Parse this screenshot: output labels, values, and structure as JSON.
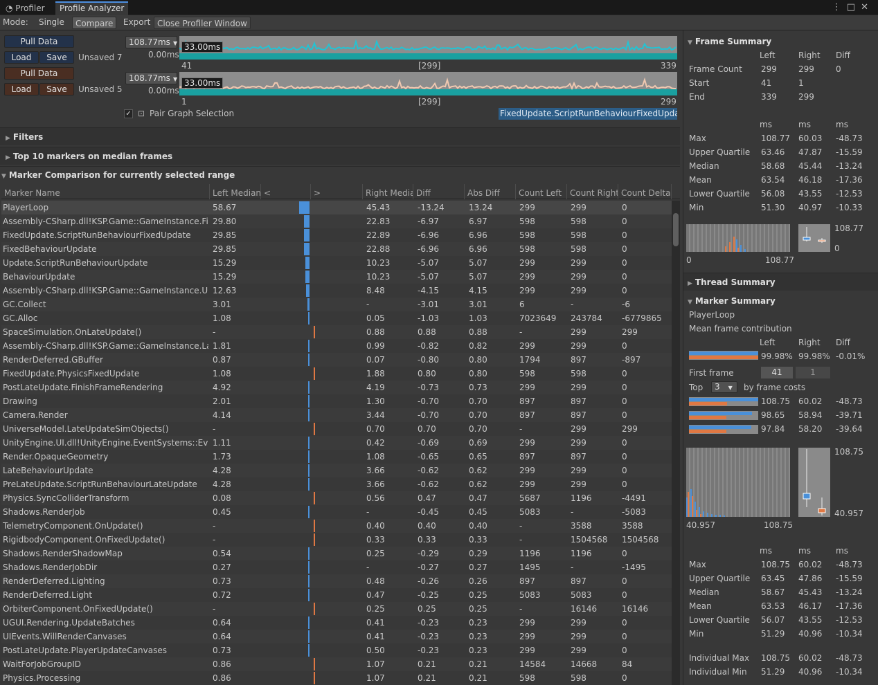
{
  "tabs": {
    "profiler": "Profiler",
    "analyzer": "Profile Analyzer"
  },
  "toolbar": {
    "mode": "Mode:",
    "single": "Single",
    "compare": "Compare",
    "export": "Export",
    "close": "Close Profiler Window"
  },
  "left_set": {
    "pull": "Pull Data",
    "load": "Load",
    "save": "Save",
    "status": "Unsaved 7",
    "max": "108.77ms",
    "min": "0.00ms",
    "target": "33.00ms",
    "axis_start": "41",
    "axis_mid": "[299]",
    "axis_end": "339"
  },
  "right_set": {
    "pull": "Pull Data",
    "load": "Load",
    "save": "Save",
    "status": "Unsaved 5",
    "max": "108.77ms",
    "min": "0.00ms",
    "target": "33.00ms",
    "axis_start": "1",
    "axis_mid": "[299]",
    "axis_end": "299"
  },
  "pair_label": "Pair Graph Selection",
  "selected_marker": "FixedUpdate.ScriptRunBehaviourFixedUpdate",
  "sections": {
    "filters": "Filters",
    "top10": "Top 10 markers on median frames",
    "comparison": "Marker Comparison for currently selected range"
  },
  "columns": [
    "Marker Name",
    "Left Median",
    "<",
    ">",
    "Right Media",
    "Diff",
    "Abs Diff",
    "Count Left",
    "Count Right",
    "Count Delta"
  ],
  "rows": [
    [
      "PlayerLoop",
      "58.67",
      "45.43",
      "-13.24",
      "13.24",
      "299",
      "299",
      "0"
    ],
    [
      "Assembly-CSharp.dll!KSP.Game::GameInstance.Fixed",
      "29.80",
      "22.83",
      "-6.97",
      "6.97",
      "598",
      "598",
      "0"
    ],
    [
      "FixedUpdate.ScriptRunBehaviourFixedUpdate",
      "29.85",
      "22.89",
      "-6.96",
      "6.96",
      "598",
      "598",
      "0"
    ],
    [
      "FixedBehaviourUpdate",
      "29.85",
      "22.88",
      "-6.96",
      "6.96",
      "598",
      "598",
      "0"
    ],
    [
      "Update.ScriptRunBehaviourUpdate",
      "15.29",
      "10.23",
      "-5.07",
      "5.07",
      "299",
      "299",
      "0"
    ],
    [
      "BehaviourUpdate",
      "15.29",
      "10.23",
      "-5.07",
      "5.07",
      "299",
      "299",
      "0"
    ],
    [
      "Assembly-CSharp.dll!KSP.Game::GameInstance.Update",
      "12.63",
      "8.48",
      "-4.15",
      "4.15",
      "299",
      "299",
      "0"
    ],
    [
      "GC.Collect",
      "3.01",
      "-",
      "-3.01",
      "3.01",
      "6",
      "-",
      "-6"
    ],
    [
      "GC.Alloc",
      "1.08",
      "0.05",
      "-1.03",
      "1.03",
      "7023649",
      "243784",
      "-6779865"
    ],
    [
      "SpaceSimulation.OnLateUpdate()",
      "-",
      "0.88",
      "0.88",
      "0.88",
      "-",
      "299",
      "299"
    ],
    [
      "Assembly-CSharp.dll!KSP.Game::GameInstance.LateU",
      "1.81",
      "0.99",
      "-0.82",
      "0.82",
      "299",
      "299",
      "0"
    ],
    [
      "RenderDeferred.GBuffer",
      "0.87",
      "0.07",
      "-0.80",
      "0.80",
      "1794",
      "897",
      "-897"
    ],
    [
      "FixedUpdate.PhysicsFixedUpdate",
      "1.08",
      "1.88",
      "0.80",
      "0.80",
      "598",
      "598",
      "0"
    ],
    [
      "PostLateUpdate.FinishFrameRendering",
      "4.92",
      "4.19",
      "-0.73",
      "0.73",
      "299",
      "299",
      "0"
    ],
    [
      "Drawing",
      "2.01",
      "1.30",
      "-0.70",
      "0.70",
      "897",
      "897",
      "0"
    ],
    [
      "Camera.Render",
      "4.14",
      "3.44",
      "-0.70",
      "0.70",
      "897",
      "897",
      "0"
    ],
    [
      "UniverseModel.LateUpdateSimObjects()",
      "-",
      "0.70",
      "0.70",
      "0.70",
      "-",
      "299",
      "299"
    ],
    [
      "UnityEngine.UI.dll!UnityEngine.EventSystems::EventS",
      "1.11",
      "0.42",
      "-0.69",
      "0.69",
      "299",
      "299",
      "0"
    ],
    [
      "Render.OpaqueGeometry",
      "1.73",
      "1.08",
      "-0.65",
      "0.65",
      "897",
      "897",
      "0"
    ],
    [
      "LateBehaviourUpdate",
      "4.28",
      "3.66",
      "-0.62",
      "0.62",
      "299",
      "299",
      "0"
    ],
    [
      "PreLateUpdate.ScriptRunBehaviourLateUpdate",
      "4.28",
      "3.66",
      "-0.62",
      "0.62",
      "299",
      "299",
      "0"
    ],
    [
      "Physics.SyncColliderTransform",
      "0.08",
      "0.56",
      "0.47",
      "0.47",
      "5687",
      "1196",
      "-4491"
    ],
    [
      "Shadows.RenderJob",
      "0.45",
      "-",
      "-0.45",
      "0.45",
      "5083",
      "-",
      "-5083"
    ],
    [
      "TelemetryComponent.OnUpdate()",
      "-",
      "0.40",
      "0.40",
      "0.40",
      "-",
      "3588",
      "3588"
    ],
    [
      "RigidbodyComponent.OnFixedUpdate()",
      "-",
      "0.33",
      "0.33",
      "0.33",
      "-",
      "1504568",
      "1504568"
    ],
    [
      "Shadows.RenderShadowMap",
      "0.54",
      "0.25",
      "-0.29",
      "0.29",
      "1196",
      "1196",
      "0"
    ],
    [
      "Shadows.RenderJobDir",
      "0.27",
      "-",
      "-0.27",
      "0.27",
      "1495",
      "-",
      "-1495"
    ],
    [
      "RenderDeferred.Lighting",
      "0.73",
      "0.48",
      "-0.26",
      "0.26",
      "897",
      "897",
      "0"
    ],
    [
      "RenderDeferred.Light",
      "0.72",
      "0.47",
      "-0.25",
      "0.25",
      "5083",
      "5083",
      "0"
    ],
    [
      "OrbiterComponent.OnFixedUpdate()",
      "-",
      "0.25",
      "0.25",
      "0.25",
      "-",
      "16146",
      "16146"
    ],
    [
      "UGUI.Rendering.UpdateBatches",
      "0.64",
      "0.41",
      "-0.23",
      "0.23",
      "299",
      "299",
      "0"
    ],
    [
      "UIEvents.WillRenderCanvases",
      "0.64",
      "0.41",
      "-0.23",
      "0.23",
      "299",
      "299",
      "0"
    ],
    [
      "PostLateUpdate.PlayerUpdateCanvases",
      "0.73",
      "0.50",
      "-0.23",
      "0.23",
      "299",
      "299",
      "0"
    ],
    [
      "WaitForJobGroupID",
      "0.86",
      "1.07",
      "0.21",
      "0.21",
      "14584",
      "14668",
      "84"
    ],
    [
      "Physics.Processing",
      "0.86",
      "1.07",
      "0.21",
      "0.21",
      "598",
      "598",
      "0"
    ]
  ],
  "frame_summary": {
    "title": "Frame Summary",
    "headers": [
      "Left",
      "Right",
      "Diff"
    ],
    "frames": [
      [
        "Frame Count",
        "299",
        "299",
        "0"
      ],
      [
        "Start",
        "41",
        "1",
        ""
      ],
      [
        "End",
        "339",
        "299",
        ""
      ]
    ],
    "unit": "ms",
    "stats": [
      [
        "Max",
        "108.77",
        "60.03",
        "-48.73"
      ],
      [
        "Upper Quartile",
        "63.46",
        "47.87",
        "-15.59"
      ],
      [
        "Median",
        "58.68",
        "45.44",
        "-13.24"
      ],
      [
        "Mean",
        "63.54",
        "46.18",
        "-17.36"
      ],
      [
        "Lower Quartile",
        "56.08",
        "43.55",
        "-12.53"
      ],
      [
        "Min",
        "51.30",
        "40.97",
        "-10.33"
      ]
    ],
    "hist_min": "0",
    "hist_max": "108.77",
    "box_max": "108.77",
    "box_min": "0"
  },
  "thread_summary": {
    "title": "Thread Summary"
  },
  "marker_summary": {
    "title": "Marker Summary",
    "marker": "PlayerLoop",
    "contribution_label": "Mean frame contribution",
    "headers": [
      "Left",
      "Right",
      "Diff"
    ],
    "contribution": [
      "99.98%",
      "99.98%",
      "-0.01%"
    ],
    "first_frame_label": "First frame",
    "first_frame_left": "41",
    "first_frame_right": "1",
    "top_label": "Top",
    "top_value": "3",
    "top_suffix": "by frame costs",
    "top_rows": [
      [
        "108.75",
        "60.02",
        "-48.73"
      ],
      [
        "98.65",
        "58.94",
        "-39.71"
      ],
      [
        "97.84",
        "58.20",
        "-39.64"
      ]
    ],
    "hist_min": "40.957",
    "hist_max": "108.75",
    "box_max": "108.75",
    "box_min": "40.957",
    "unit": "ms",
    "stats": [
      [
        "Max",
        "108.75",
        "60.02",
        "-48.73"
      ],
      [
        "Upper Quartile",
        "63.45",
        "47.86",
        "-15.59"
      ],
      [
        "Median",
        "58.67",
        "45.43",
        "-13.24"
      ],
      [
        "Mean",
        "63.53",
        "46.17",
        "-17.36"
      ],
      [
        "Lower Quartile",
        "56.07",
        "43.55",
        "-12.53"
      ],
      [
        "Min",
        "51.29",
        "40.96",
        "-10.34"
      ]
    ],
    "individual": [
      [
        "Individual Max",
        "108.75",
        "60.02",
        "-48.73"
      ],
      [
        "Individual Min",
        "51.29",
        "40.96",
        "-10.34"
      ]
    ]
  },
  "colors": {
    "left": "#4a90d9",
    "right": "#e07843",
    "graph_left": "#22c4d4",
    "graph_right": "#f0c8b0",
    "teal": "#1aa0a0"
  }
}
